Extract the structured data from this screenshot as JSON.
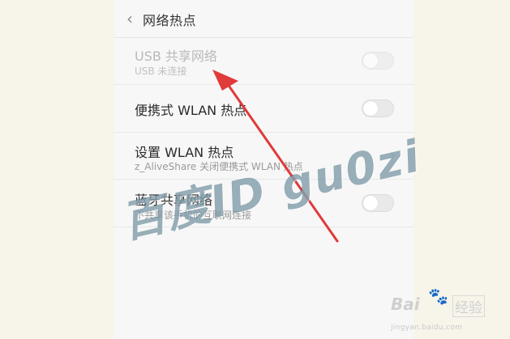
{
  "header": {
    "back_icon": "chevron-left-icon",
    "title": "网络热点"
  },
  "rows": [
    {
      "label": "USB 共享网络",
      "sub": "USB 未连接",
      "control": "toggle",
      "enabled": false,
      "toggle_on": false
    },
    {
      "label": "便携式 WLAN 热点",
      "sub": "",
      "control": "toggle",
      "enabled": true,
      "toggle_on": false
    },
    {
      "label": "设置 WLAN 热点",
      "sub": "z_AliveShare 关闭便携式 WLAN 热点",
      "control": "chevron",
      "enabled": true
    },
    {
      "label": "蓝牙共享网络",
      "sub": "不共享该手机的互联网连接",
      "control": "toggle",
      "enabled": true,
      "toggle_on": false
    }
  ],
  "watermark": {
    "text": "百度ID gu0zi"
  },
  "annotation": {
    "type": "arrow",
    "color": "#e03a3a",
    "points_to": "USB 共享网络"
  },
  "logo": {
    "brand": "Bai",
    "paw_icon": "paw-icon",
    "brand_suffix": "经验",
    "url": "jingyan.baidu.com"
  },
  "colors": {
    "background": "#f7f7f7",
    "page_margin": "#f7f4ea",
    "watermark": "#46708a",
    "arrow": "#e03a3a"
  }
}
